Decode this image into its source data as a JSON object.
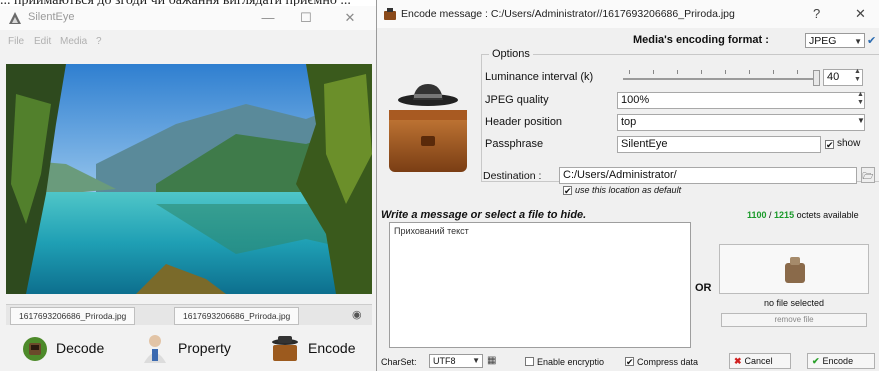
{
  "top_caption": "... приймаються до згоди чи бажання виглядати приємно ...",
  "main_window": {
    "title": "SilentEye",
    "window_buttons": {
      "minimize": "—",
      "maximize": "☐",
      "close": "✕"
    },
    "menu": [
      "File",
      "Edit",
      "Media",
      "?"
    ],
    "tabs": [
      "1617693206686_Priroda.jpg",
      "1617693206686_Priroda.jpg"
    ],
    "actions": {
      "decode": "Decode",
      "property": "Property",
      "encode": "Encode"
    }
  },
  "dialog": {
    "title": "Encode message : C:/Users/Administrator//1617693206686_Priroda.jpg",
    "help_button": "?",
    "close_button": "✕",
    "format_label": "Media's encoding format :",
    "format_value": "JPEG",
    "options": {
      "group_title": "Options",
      "luminance_label": "Luminance interval (k)",
      "luminance_value": "40",
      "luminance_fraction": 0.95,
      "jpeg_quality_label": "JPEG quality",
      "jpeg_quality_value": "100%",
      "header_position_label": "Header position",
      "header_position_value": "top",
      "passphrase_label": "Passphrase",
      "passphrase_value": "SilentEye",
      "show_label": "show",
      "show_checked": true
    },
    "destination": {
      "label": "Destination :",
      "value": "C:/Users/Administrator/",
      "default_label": "use this location as default",
      "default_checked": true
    },
    "message_heading": "Write a message or select a file to hide.",
    "octets": {
      "used": "1100",
      "total": "1215",
      "suffix": "octets available"
    },
    "message_text": "Прихований текст",
    "or_label": "OR",
    "file": {
      "status": "no file selected",
      "remove_label": "remove file"
    },
    "bottom": {
      "charset_label": "CharSet:",
      "charset_value": "UTF8",
      "encryption_label": "Enable encryptio",
      "encryption_checked": false,
      "compress_label": "Compress data",
      "compress_checked": true,
      "cancel_label": "Cancel",
      "encode_label": "Encode"
    }
  }
}
